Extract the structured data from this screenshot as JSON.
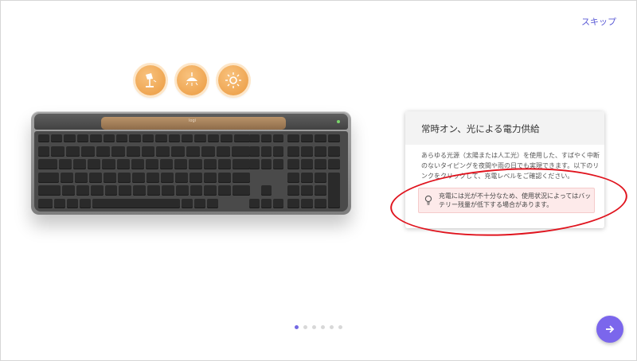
{
  "header": {
    "skip_label": "スキップ"
  },
  "light_icons": [
    "desk-lamp-icon",
    "ceiling-lamp-icon",
    "sun-icon"
  ],
  "keyboard": {
    "brand": "logi"
  },
  "card": {
    "title": "常時オン、光による電力供給",
    "description": "あらゆる光源（太陽または人工光）を使用した、すばやく中断のないタイピングを夜間や雨の日でも実現できます。以下のリンクをクリックして、充電レベルをご確認ください。",
    "warning": "充電には光が不十分なため、使用状況によってはバッテリー残量が低下する場合があります。"
  },
  "pager": {
    "total": 6,
    "current": 1
  },
  "colors": {
    "accent": "#7b66ec",
    "warning_bg": "#fdeaea",
    "annotation": "#e0141e",
    "solar_panel": "#a47f5a"
  }
}
